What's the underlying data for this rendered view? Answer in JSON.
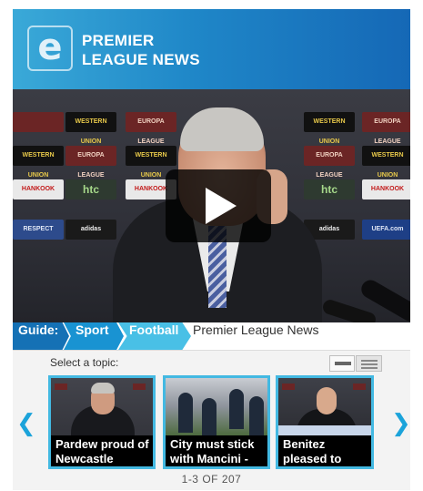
{
  "header": {
    "logo_letter": "e",
    "title_line1": "PREMIER",
    "title_line2": "LEAGUE NEWS"
  },
  "video": {
    "play_icon": "play-icon",
    "sponsors": [
      "WESTERN UNION",
      "EUROPA LEAGUE",
      "htc",
      "HANKOOK",
      "adidas",
      "RESPECT",
      "UEFA.com"
    ]
  },
  "breadcrumb": {
    "guide": "Guide:",
    "sport": "Sport",
    "football": "Football",
    "current": "Premier League News"
  },
  "topics": {
    "label": "Select a topic:",
    "items": [
      {
        "caption": "Pardew proud of Newcastle"
      },
      {
        "caption": "City must stick with Mancini -"
      },
      {
        "caption": "Benitez pleased to"
      }
    ],
    "pager": "1-3 OF 207"
  },
  "colors": {
    "header_start": "#3aa9d8",
    "header_end": "#1568b6",
    "guide": "#1571b5",
    "sport": "#1993d2",
    "football": "#49c0e6",
    "thumb_border": "#43b9e2"
  }
}
